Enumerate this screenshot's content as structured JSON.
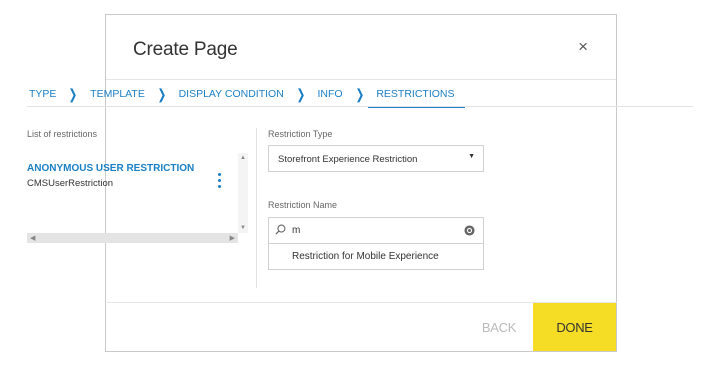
{
  "dialog": {
    "title": "Create Page",
    "close_icon": "×"
  },
  "wizard": {
    "steps": [
      "TYPE",
      "TEMPLATE",
      "DISPLAY CONDITION",
      "INFO",
      "RESTRICTIONS"
    ],
    "active_step": "RESTRICTIONS",
    "separator_icon": "chevron-right-icon"
  },
  "restrictions_list": {
    "label": "List of restrictions",
    "items": [
      {
        "name": "ANONYMOUS USER RESTRICTION",
        "type": "CMSUserRestriction"
      }
    ]
  },
  "restriction_type": {
    "label": "Restriction Type",
    "selected": "Storefront Experience Restriction"
  },
  "restriction_name": {
    "label": "Restriction Name",
    "search_value": "m",
    "results": [
      "Restriction for Mobile Experience"
    ]
  },
  "footer": {
    "back_label": "BACK",
    "done_label": "DONE"
  },
  "colors": {
    "accent": "#1a7fc4",
    "done_button": "#f5dd26",
    "disabled_text": "#bbbbbb"
  }
}
